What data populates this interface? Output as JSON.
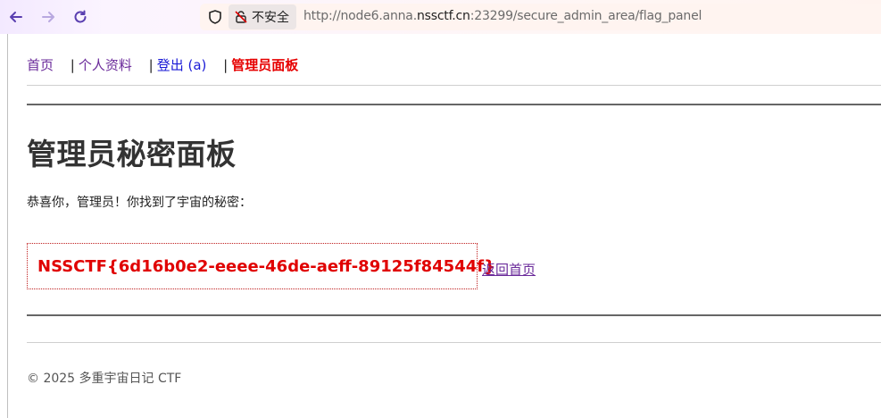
{
  "browser": {
    "security_label": "不安全",
    "url_prefix": "http://node6.anna.",
    "url_host": "nssctf.cn",
    "url_rest": ":23299/secure_admin_area/flag_panel"
  },
  "nav": {
    "home": "首页",
    "separator": "|",
    "profile": "个人资料",
    "logout": "登出 (a)",
    "admin": "管理员面板"
  },
  "main": {
    "title": "管理员秘密面板",
    "message": "恭喜你，管理员！你找到了宇宙的秘密：",
    "flag": "NSSCTF{6d16b0e2-eeee-46de-aeff-89125f84544f}",
    "back_link": "返回首页"
  },
  "footer": {
    "text": "© 2025 多重宇宙日记 CTF"
  },
  "colors": {
    "flag_red": "#e00000",
    "visited_link": "#6a2a9a",
    "link_blue": "#1a1ad6"
  }
}
